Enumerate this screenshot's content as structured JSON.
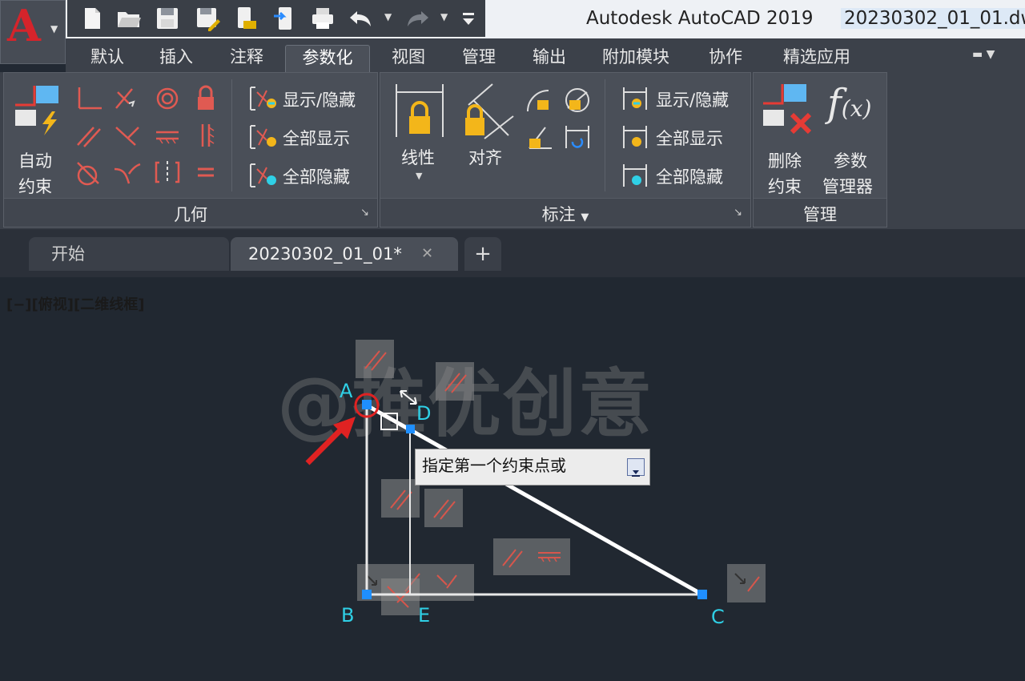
{
  "titlebar": {
    "app_title": "Autodesk AutoCAD 2019",
    "doc_title": "20230302_01_01.dw"
  },
  "quick_access": [
    "new-icon",
    "open-icon",
    "save-icon",
    "save-as-icon",
    "open-from-mobile-icon",
    "save-to-mobile-icon",
    "plot-icon",
    "undo-icon",
    "redo-icon",
    "customize-icon"
  ],
  "ribbon_tabs": [
    "默认",
    "插入",
    "注释",
    "参数化",
    "视图",
    "管理",
    "输出",
    "附加模块",
    "协作",
    "精选应用"
  ],
  "active_tab": "参数化",
  "panels": {
    "geometric": {
      "title": "几何",
      "auto_constrain": [
        "自动",
        "约束"
      ],
      "show_hide": "显示/隐藏",
      "show_all": "全部显示",
      "hide_all": "全部隐藏"
    },
    "dimensional": {
      "title": "标注",
      "linear": "线性",
      "aligned": "对齐",
      "show_hide": "显示/隐藏",
      "show_all": "全部显示",
      "hide_all": "全部隐藏"
    },
    "manage": {
      "title": "管理",
      "delete_constraints": [
        "删除",
        "约束"
      ],
      "param_manager": [
        "参数",
        "管理器"
      ]
    }
  },
  "doc_tabs": [
    {
      "label": "开始",
      "active": false
    },
    {
      "label": "20230302_01_01*",
      "active": true
    }
  ],
  "canvas": {
    "viewport_label": "[−][俯视][二维线框]",
    "watermark": "@推优创意",
    "tooltip": "指定第一个约束点或",
    "points": {
      "A": "A",
      "B": "B",
      "C": "C",
      "D": "D",
      "E": "E"
    }
  },
  "colors": {
    "accent_red": "#d5242b",
    "grip_blue": "#1f8fff",
    "point_label": "#2fd0e6"
  }
}
